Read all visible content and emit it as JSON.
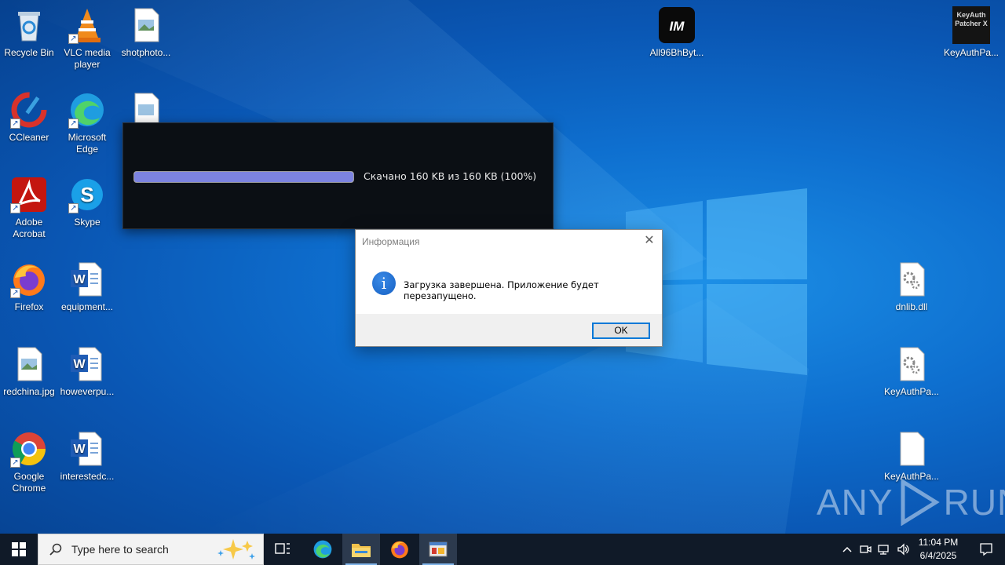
{
  "desktop": {
    "icons": [
      {
        "label": "Recycle Bin",
        "icon": "recycle-bin-icon"
      },
      {
        "label": "VLC media player",
        "icon": "vlc-icon"
      },
      {
        "label": "shotphoto...",
        "icon": "image-file-icon"
      },
      {
        "label": "CCleaner",
        "icon": "ccleaner-icon"
      },
      {
        "label": "Microsoft Edge",
        "icon": "edge-icon"
      },
      {
        "label": "Adobe Acrobat",
        "icon": "acrobat-icon"
      },
      {
        "label": "Skype",
        "icon": "skype-icon"
      },
      {
        "label": "Firefox",
        "icon": "firefox-icon"
      },
      {
        "label": "equipment...",
        "icon": "word-doc-icon"
      },
      {
        "label": "redchina.jpg",
        "icon": "image-file-icon"
      },
      {
        "label": "howeverpu...",
        "icon": "word-doc-icon"
      },
      {
        "label": "Google Chrome",
        "icon": "chrome-icon"
      },
      {
        "label": "interestedc...",
        "icon": "word-doc-icon"
      },
      {
        "label": "All96BhByt...",
        "icon": "app-icon"
      },
      {
        "label": "KeyAuthPa...",
        "icon": "keyauth-patcher-icon"
      },
      {
        "label": "dnlib.dll",
        "icon": "dll-file-icon"
      },
      {
        "label": "KeyAuthPa...",
        "icon": "dll-file-icon"
      },
      {
        "label": "KeyAuthPa...",
        "icon": "blank-file-icon"
      }
    ],
    "patcher_icon_text": "KeyAuth Patcher X",
    "app_icon_text": "IM"
  },
  "progress_window": {
    "status_text": "Скачано 160 KB из 160 KB (100%)",
    "progress_percent": 100
  },
  "dialog": {
    "title": "Информация",
    "message": "Загрузка завершена. Приложение будет перезапущено.",
    "ok_label": "OK",
    "info_glyph": "i",
    "close_glyph": "✕"
  },
  "watermark": {
    "left": "ANY",
    "right": "RUN"
  },
  "taskbar": {
    "search_placeholder": "Type here to search",
    "time": "11:04 PM",
    "date": "6/4/2025",
    "pinned": [
      "task-view-icon",
      "edge-icon",
      "file-explorer-icon",
      "firefox-icon",
      "app-window-icon"
    ]
  },
  "colors": {
    "accent": "#0078d7",
    "progress_fill": "#7c83e0",
    "taskbar": "#101a28"
  }
}
